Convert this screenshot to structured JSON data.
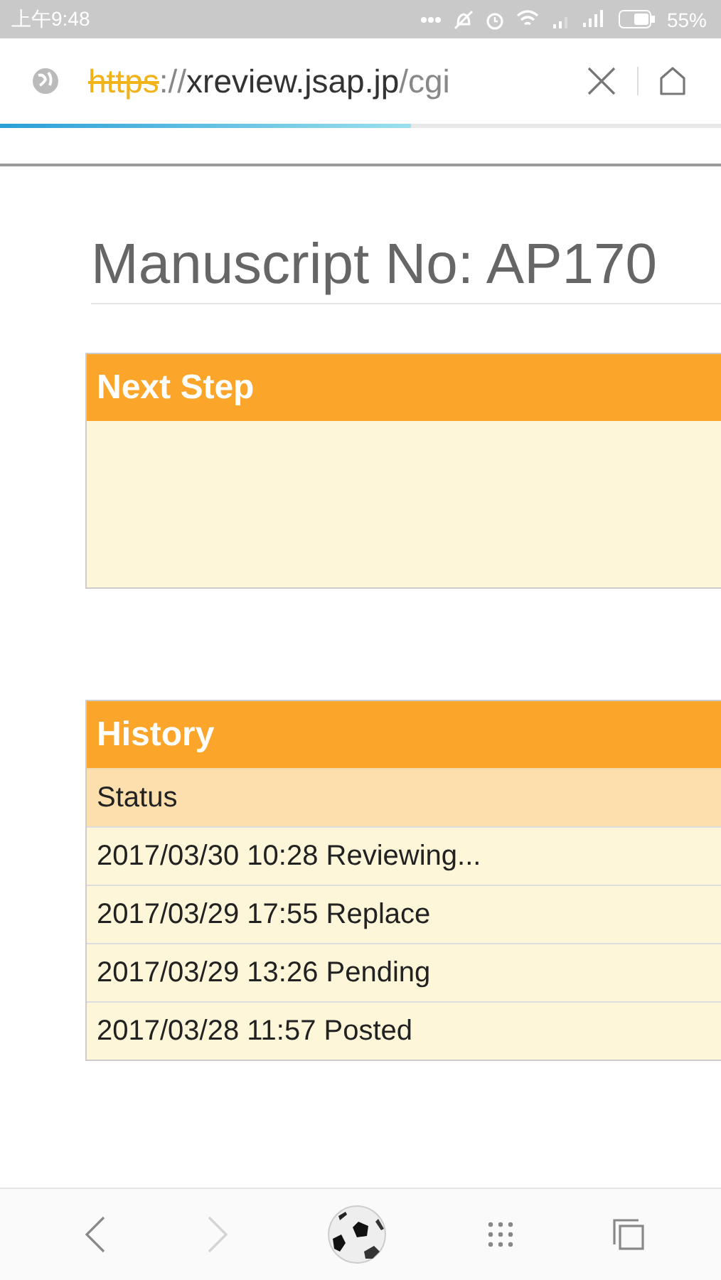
{
  "status_bar": {
    "time": "上午9:48",
    "battery": "55%"
  },
  "url_bar": {
    "scheme": "https",
    "scheme_insecure": true,
    "separator": "://",
    "host": "xreview.jsap.jp",
    "path": "/cgi",
    "progress": {
      "level": 0.57
    }
  },
  "page": {
    "title": "Manuscript No: AP170",
    "next_step": {
      "heading": "Next Step"
    },
    "history": {
      "heading": "History",
      "column": "Status",
      "rows": [
        {
          "text": "2017/03/30 10:28 Reviewing..."
        },
        {
          "text": "2017/03/29 17:55 Replace"
        },
        {
          "text": "2017/03/29 13:26 Pending"
        },
        {
          "text": "2017/03/28 11:57 Posted"
        }
      ]
    }
  },
  "bottom_nav": [
    {
      "kind": "back",
      "disabled": false
    },
    {
      "kind": "forward",
      "disabled": true
    },
    {
      "kind": "home"
    },
    {
      "kind": "menu"
    },
    {
      "kind": "tabs"
    }
  ]
}
